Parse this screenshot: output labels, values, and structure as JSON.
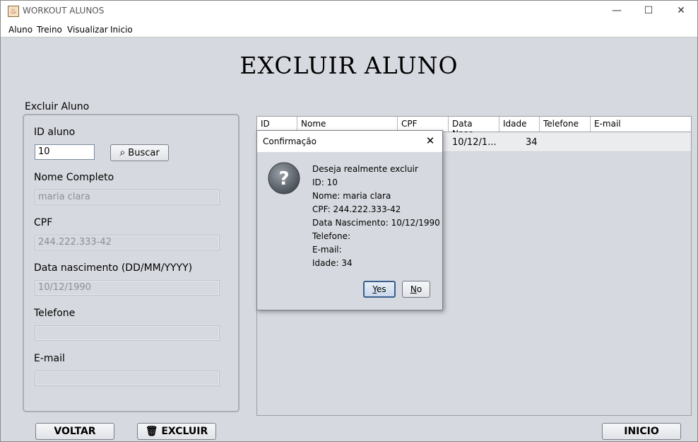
{
  "window": {
    "title": "WORKOUT ALUNOS",
    "controls": {
      "minimize": "—",
      "maximize": "☐",
      "close": "✕"
    }
  },
  "menu": [
    "Aluno",
    "Treino",
    "Visualizar",
    "Inicio"
  ],
  "page_title": "EXCLUIR ALUNO",
  "form": {
    "group_label": "Excluir Aluno",
    "id_label": "ID aluno",
    "id_value": "10",
    "search_button": "Buscar",
    "name_label": "Nome Completo",
    "name_value": "maria clara",
    "cpf_label": "CPF",
    "cpf_value": "244.222.333-42",
    "birth_label": "Data nascimento (DD/MM/YYYY)",
    "birth_value": "10/12/1990",
    "phone_label": "Telefone",
    "phone_value": "",
    "email_label": "E-mail",
    "email_value": ""
  },
  "table": {
    "columns": [
      "ID",
      "Nome",
      "CPF",
      "Data Nasc",
      "Idade",
      "Telefone",
      "E-mail"
    ],
    "row": {
      "data_nasc": "10/12/1...",
      "idade": "34"
    }
  },
  "footer": {
    "back_button": "VOLTAR",
    "delete_button": "EXCLUIR",
    "home_button": "INICIO"
  },
  "dialog": {
    "title": "Confirmação",
    "close": "✕",
    "icon": "question-icon",
    "lines": [
      "Deseja realmente excluir",
      "ID: 10",
      "Nome: maria clara",
      "CPF: 244.222.333-42",
      "Data Nascimento: 10/12/1990",
      "Telefone:",
      "E-mail:",
      "Idade: 34"
    ],
    "yes_button": "Yes",
    "no_button": "No"
  }
}
